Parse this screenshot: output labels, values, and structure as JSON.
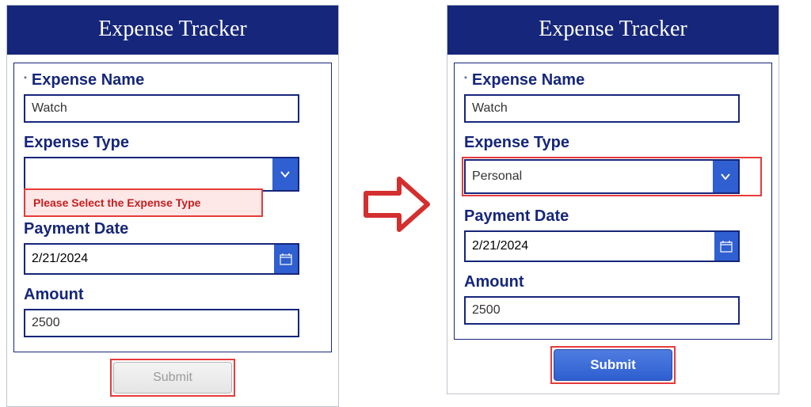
{
  "app_title": "Expense Tracker",
  "left": {
    "expense_name_label": "Expense Name",
    "expense_name_value": "Watch",
    "expense_type_label": "Expense Type",
    "expense_type_value": "",
    "expense_type_error": "Please Select the Expense Type",
    "payment_date_label": "Payment Date",
    "payment_date_value": "2/21/2024",
    "amount_label": "Amount",
    "amount_value": "2500",
    "submit_label": "Submit"
  },
  "right": {
    "expense_name_label": "Expense Name",
    "expense_name_value": "Watch",
    "expense_type_label": "Expense Type",
    "expense_type_value": "Personal",
    "payment_date_label": "Payment Date",
    "payment_date_value": "2/21/2024",
    "amount_label": "Amount",
    "amount_value": "2500",
    "submit_label": "Submit"
  },
  "colors": {
    "brand": "#16267a",
    "accent": "#2f5fd0",
    "error": "#e63b3b"
  }
}
